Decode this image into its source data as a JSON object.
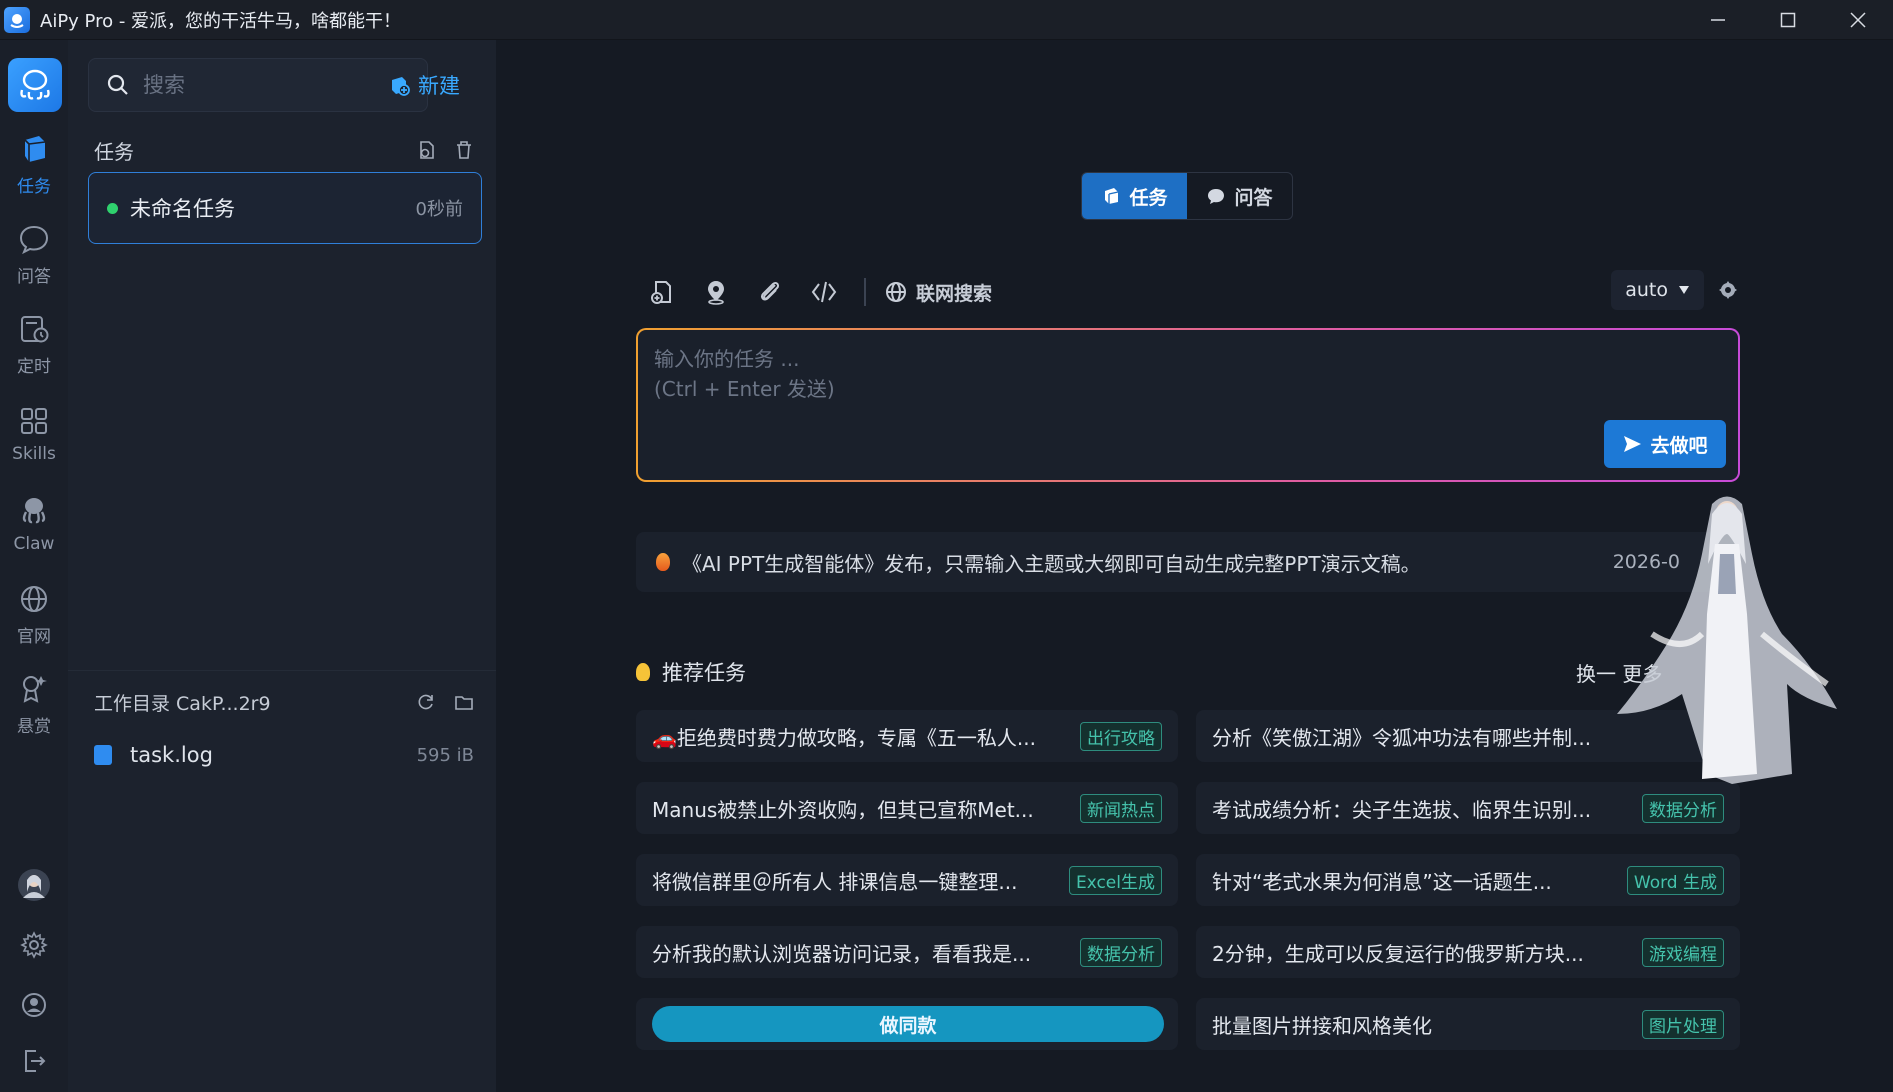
{
  "window": {
    "title": "AiPy Pro - 爱派，您的干活牛马，啥都能干！"
  },
  "rail": {
    "items": [
      {
        "label": "任务",
        "icon": "task-cube-icon"
      },
      {
        "label": "问答",
        "icon": "chat-bubble-icon"
      },
      {
        "label": "定时",
        "icon": "schedule-icon"
      },
      {
        "label": "Skills",
        "icon": "grid-icon"
      },
      {
        "label": "Claw",
        "icon": "octopus-icon"
      },
      {
        "label": "官网",
        "icon": "globe-icon"
      },
      {
        "label": "悬赏",
        "icon": "reward-icon"
      }
    ]
  },
  "sidebar": {
    "search_placeholder": "搜索",
    "new_label": "新建",
    "tasks_header": "任务",
    "tasks": [
      {
        "name": "未命名任务",
        "time": "0秒前",
        "status": "active"
      }
    ],
    "workdir_label": "工作目录 CakP...2r9",
    "files": [
      {
        "name": "task.log",
        "size": "595 iB"
      }
    ]
  },
  "main": {
    "mode_tabs": [
      "任务",
      "问答"
    ],
    "web_search_label": "联网搜索",
    "model": "auto",
    "input_placeholder": "输入你的任务 ...\n(Ctrl + Enter 发送)",
    "go_label": "去做吧",
    "news": {
      "text": "《AI PPT生成智能体》发布，只需输入主题或大纲即可自动生成完整PPT演示文稿。",
      "date": "2026-0"
    },
    "recommend_header": "推荐任务",
    "refresh_label": "换一 更多",
    "recommendations": [
      {
        "text": "🚗拒绝费时费力做攻略，专属《五一私人...",
        "tag": "出行攻略",
        "tag_style": "green"
      },
      {
        "text": "分析《笑傲江湖》令狐冲功法有哪些并制...",
        "tag": "",
        "tag_style": "green"
      },
      {
        "text": "Manus被禁止外资收购，但其已宣称Met...",
        "tag": "新闻热点",
        "tag_style": "green"
      },
      {
        "text": "考试成绩分析：尖子生选拔、临界生识别...",
        "tag": "数据分析",
        "tag_style": "green"
      },
      {
        "text": "将微信群里＠所有人 排课信息一键整理...",
        "tag": "Excel生成",
        "tag_style": "green"
      },
      {
        "text": "针对“老式水果为何消息”这一话题生...",
        "tag": "Word 生成",
        "tag_style": "green"
      },
      {
        "text": "分析我的默认浏览器访问记录，看看我是...",
        "tag": "数据分析",
        "tag_style": "green"
      },
      {
        "text": "2分钟，生成可以反复运行的俄罗斯方块...",
        "tag": "游戏编程",
        "tag_style": "green"
      },
      {
        "text": "",
        "tag": "",
        "tag_style": "",
        "button": "做同款"
      },
      {
        "text": "批量图片拼接和风格美化",
        "tag": "图片处理",
        "tag_style": "green"
      }
    ]
  }
}
